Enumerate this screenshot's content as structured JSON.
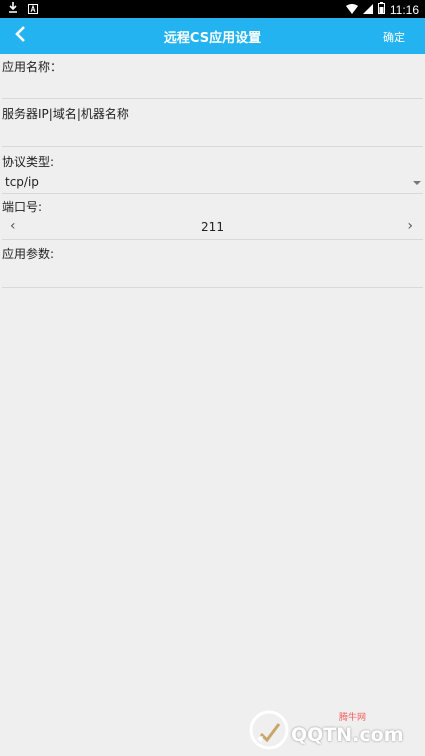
{
  "status_bar": {
    "time": "11:16"
  },
  "app_bar": {
    "title": "远程CS应用设置",
    "confirm_label": "确定",
    "color": "#22b3f0"
  },
  "form": {
    "app_name_label": "应用名称：",
    "app_name_value": "",
    "server_label": "服务器IP|域名|机器名称",
    "server_value": "",
    "protocol_label": "协议类型:",
    "protocol_value": "tcp/ip",
    "port_label": "端口号:",
    "port_value": "211",
    "params_label": "应用参数:",
    "params_value": ""
  },
  "watermark": {
    "text": "QQTN.com",
    "sub": "腾牛网"
  }
}
